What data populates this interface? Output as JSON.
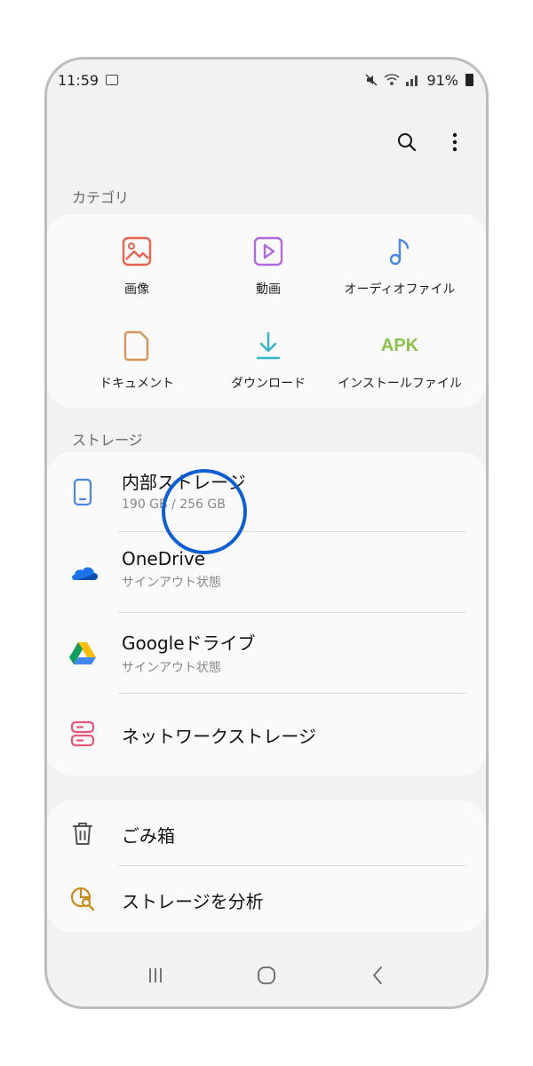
{
  "status_bar": {
    "time": "11:59",
    "battery": "91%"
  },
  "toolbar": {
    "search_icon": "search-icon",
    "more_icon": "more-vert-icon"
  },
  "categories": {
    "heading": "カテゴリ",
    "items": [
      {
        "label": "画像",
        "icon": "image-icon",
        "color": "#e8644f"
      },
      {
        "label": "動画",
        "icon": "video-icon",
        "color": "#b06ae0"
      },
      {
        "label": "オーディオファイル",
        "icon": "music-note-icon",
        "color": "#4a86e8"
      },
      {
        "label": "ドキュメント",
        "icon": "document-icon",
        "color": "#d9945a"
      },
      {
        "label": "ダウンロード",
        "icon": "download-icon",
        "color": "#2fb6c8"
      },
      {
        "label": "インストールファイル",
        "icon": "apk-icon",
        "color": "#8bc34a",
        "icon_text": "APK"
      }
    ]
  },
  "storage": {
    "heading": "ストレージ",
    "items": [
      {
        "title": "内部ストレージ",
        "subtitle": "190 GB / 256 GB",
        "icon": "phone-icon"
      },
      {
        "title": "OneDrive",
        "subtitle": "サインアウト状態",
        "icon": "onedrive-icon"
      },
      {
        "title": "Googleドライブ",
        "subtitle": "サインアウト状態",
        "icon": "google-drive-icon"
      },
      {
        "title": "ネットワークストレージ",
        "subtitle": "",
        "icon": "network-storage-icon"
      }
    ]
  },
  "utilities": {
    "items": [
      {
        "title": "ごみ箱",
        "icon": "trash-icon"
      },
      {
        "title": "ストレージを分析",
        "icon": "analyze-storage-icon"
      }
    ]
  },
  "nav": {
    "recent": "recent-apps-icon",
    "home": "home-icon",
    "back": "back-icon"
  }
}
